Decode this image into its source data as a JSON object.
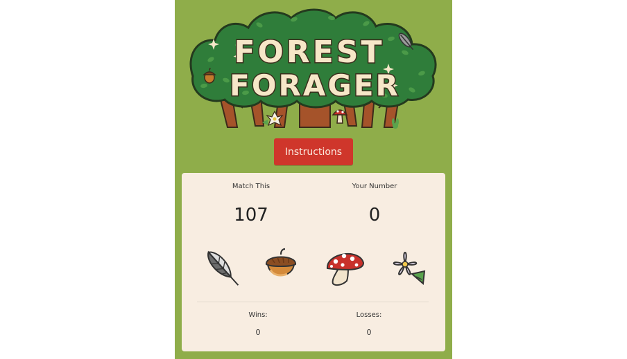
{
  "game": {
    "title_line1": "FOREST",
    "title_line2": "FORAGER",
    "background_color": "#8fad4a",
    "panel_color": "#f8ede1"
  },
  "toolbar": {
    "instructions_label": "Instructions",
    "instructions_color": "#cf362b"
  },
  "target": {
    "label": "Match This",
    "value": "107"
  },
  "current": {
    "label": "Your Number",
    "value": "0"
  },
  "items": [
    {
      "name": "feather-icon"
    },
    {
      "name": "acorn-icon"
    },
    {
      "name": "mushroom-icon"
    },
    {
      "name": "flower-icon"
    }
  ],
  "stats": {
    "wins_label": "Wins:",
    "wins_value": "0",
    "losses_label": "Losses:",
    "losses_value": "0"
  }
}
